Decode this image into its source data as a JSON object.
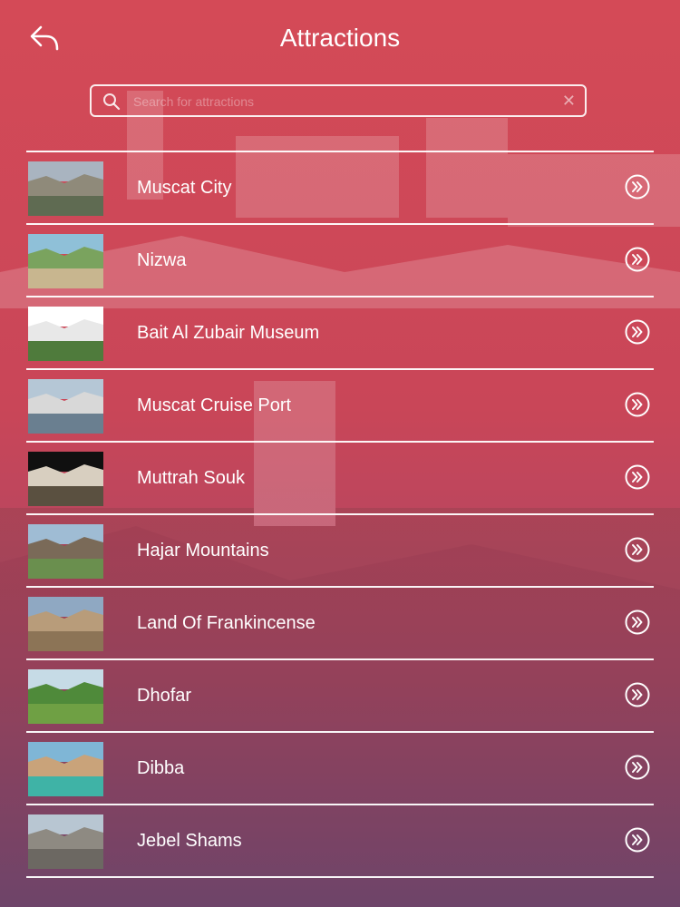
{
  "header": {
    "title": "Attractions",
    "back_icon": "back-arrow-icon"
  },
  "search": {
    "placeholder": "Search for attractions",
    "value": "",
    "icon": "search-icon",
    "clear_icon": "clear-icon"
  },
  "attractions": [
    {
      "name": "Muscat City",
      "thumb_colors": [
        "#a9b4c0",
        "#8f8a7a",
        "#5f6b52"
      ]
    },
    {
      "name": "Nizwa",
      "thumb_colors": [
        "#8fc0d8",
        "#7aa35e",
        "#c8b68f"
      ]
    },
    {
      "name": "Bait Al Zubair Museum",
      "thumb_colors": [
        "#ffffff",
        "#e8e8e8",
        "#4f7b3c"
      ]
    },
    {
      "name": "Muscat Cruise Port",
      "thumb_colors": [
        "#b5c7d6",
        "#d8d8d8",
        "#6a7f90"
      ]
    },
    {
      "name": "Muttrah Souk",
      "thumb_colors": [
        "#101010",
        "#d8cfc0",
        "#5a5040"
      ]
    },
    {
      "name": "Hajar Mountains",
      "thumb_colors": [
        "#9fbcd4",
        "#7a6a58",
        "#6a8f4e"
      ]
    },
    {
      "name": "Land Of Frankincense",
      "thumb_colors": [
        "#8fa8c2",
        "#b89c7a",
        "#8c7456"
      ]
    },
    {
      "name": "Dhofar",
      "thumb_colors": [
        "#c6dbe6",
        "#4f8a3a",
        "#6fa044"
      ]
    },
    {
      "name": "Dibba",
      "thumb_colors": [
        "#7fb6d6",
        "#c9a37a",
        "#3fb3a6"
      ]
    },
    {
      "name": "Jebel Shams",
      "thumb_colors": [
        "#b8c6d2",
        "#8e8a82",
        "#6c6862"
      ]
    }
  ],
  "row_action_icon": "chevron-double-right-circle-icon",
  "colors": {
    "accent_top": "#d44a57",
    "accent_bottom": "#7a4a78",
    "text": "#ffffff"
  }
}
